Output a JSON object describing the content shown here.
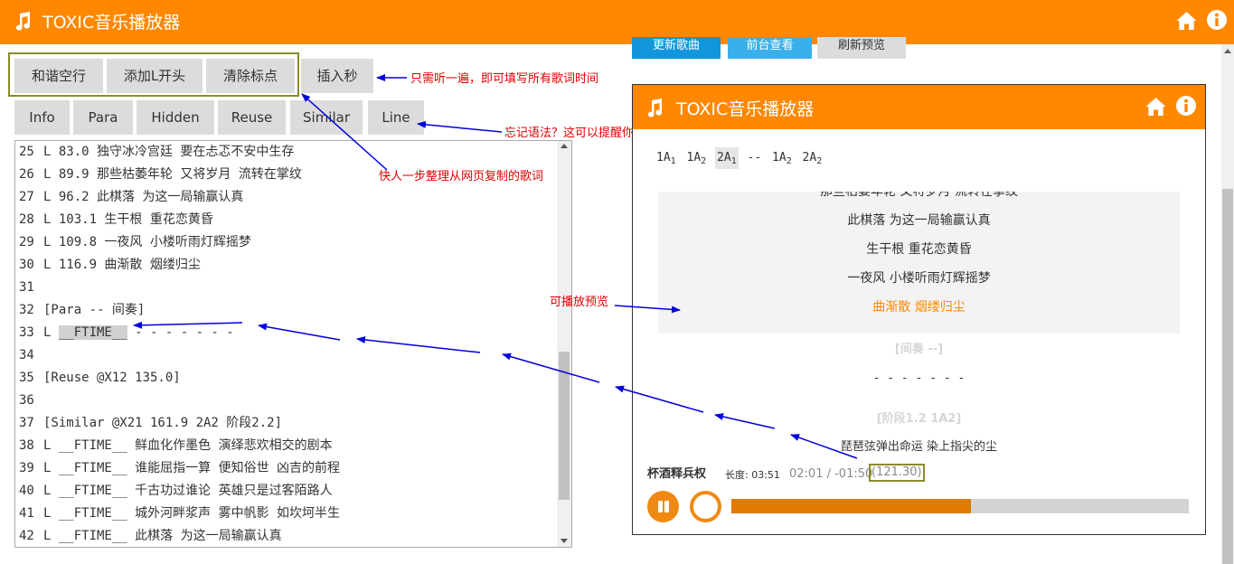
{
  "app": {
    "title": "TOXIC音乐播放器"
  },
  "hidden_toolbar": {
    "update_song": "更新歌曲",
    "back_to_top": "前台查看",
    "refresh_preview": "刷新预览"
  },
  "toolbar": {
    "harmony_blank": "和谐空行",
    "add_l_prefix": "添加L开头",
    "clear_marks": "清除标点",
    "insert_seconds": "插入秒",
    "info": "Info",
    "para": "Para",
    "hidden": "Hidden",
    "reuse": "Reuse",
    "similar": "Similar",
    "line": "Line"
  },
  "annotations": {
    "listen_once": "只需听一遍，即可填写所有歌词时间",
    "forgot_syntax": "忘记语法？这可以提醒你",
    "organize_lyrics": "快人一步整理从网页复制的歌词",
    "preview": "可播放预览"
  },
  "editor": {
    "lines": [
      {
        "n": "25",
        "text": "L 83.0 独守冰冷宫廷 要在忐忑不安中生存"
      },
      {
        "n": "26",
        "text": "L 89.9 那些枯萎年轮 又将岁月 流转在掌纹"
      },
      {
        "n": "27",
        "text": "L 96.2 此棋落 为这一局输赢认真"
      },
      {
        "n": "28",
        "text": "L 103.1 生干根 重花恋黄昏"
      },
      {
        "n": "29",
        "text": "L 109.8 一夜风 小楼听雨灯辉摇梦"
      },
      {
        "n": "30",
        "text": "L 116.9 曲渐散 烟缕归尘"
      },
      {
        "n": "31",
        "text": ""
      },
      {
        "n": "32",
        "text": "[Para -- 间奏]"
      },
      {
        "n": "33",
        "text_before": "L ",
        "highlight": "__FTIME__",
        "text_after": " - - - - - - -"
      },
      {
        "n": "34",
        "text": ""
      },
      {
        "n": "35",
        "text": "[Reuse @X12 135.0]"
      },
      {
        "n": "36",
        "text": ""
      },
      {
        "n": "37",
        "text": "[Similar @X21 161.9 2A2 阶段2.2]"
      },
      {
        "n": "38",
        "text": "L __FTIME__ 鲜血化作墨色 演绎悲欢相交的剧本"
      },
      {
        "n": "39",
        "text": "L __FTIME__ 谁能屈指一算 便知俗世 凶吉的前程"
      },
      {
        "n": "40",
        "text": "L __FTIME__ 千古功过谁论 英雄只是过客陌路人"
      },
      {
        "n": "41",
        "text": "L __FTIME__ 城外河畔浆声 雾中帆影 如坎坷半生"
      },
      {
        "n": "42",
        "text": "L __FTIME__ 此棋落 为这一局输赢认真"
      }
    ]
  },
  "player": {
    "title": "TOXIC音乐播放器",
    "structure": [
      {
        "base": "1A",
        "sub": "1",
        "active": false
      },
      {
        "base": "1A",
        "sub": "2",
        "active": false
      },
      {
        "base": "2A",
        "sub": "1",
        "active": true
      },
      {
        "base": "--",
        "sub": "",
        "active": false
      },
      {
        "base": "1A",
        "sub": "2",
        "active": false
      },
      {
        "base": "2A",
        "sub": "2",
        "active": false
      }
    ],
    "lyrics": [
      {
        "text": "那些枯萎年轮 又将岁月 流转在掌纹",
        "current": false
      },
      {
        "text": "此棋落 为这一局输赢认真",
        "current": false
      },
      {
        "text": "生干根 重花恋黄昏",
        "current": false
      },
      {
        "text": "一夜风 小楼听雨灯辉摇梦",
        "current": false
      },
      {
        "text": "曲渐散 烟缕归尘",
        "current": true
      }
    ],
    "interlude_label": "[间奏 --]",
    "interlude_dashes": "- - - - - - -",
    "stage_label": "[阶段1.2 1A2]",
    "next_lyric": "琵琶弦弹出命运 染上指尖的尘",
    "song_name": "杯酒释兵权",
    "length_label": "长度: 03:51",
    "time_display": "02:01 / -01:50",
    "position_seconds": "(121.30)",
    "progress": 0.524
  },
  "colors": {
    "accent": "#ff8800",
    "annotation": "#e00000",
    "arrow": "#0000dd",
    "highlight_box": "#8b8b2e"
  }
}
